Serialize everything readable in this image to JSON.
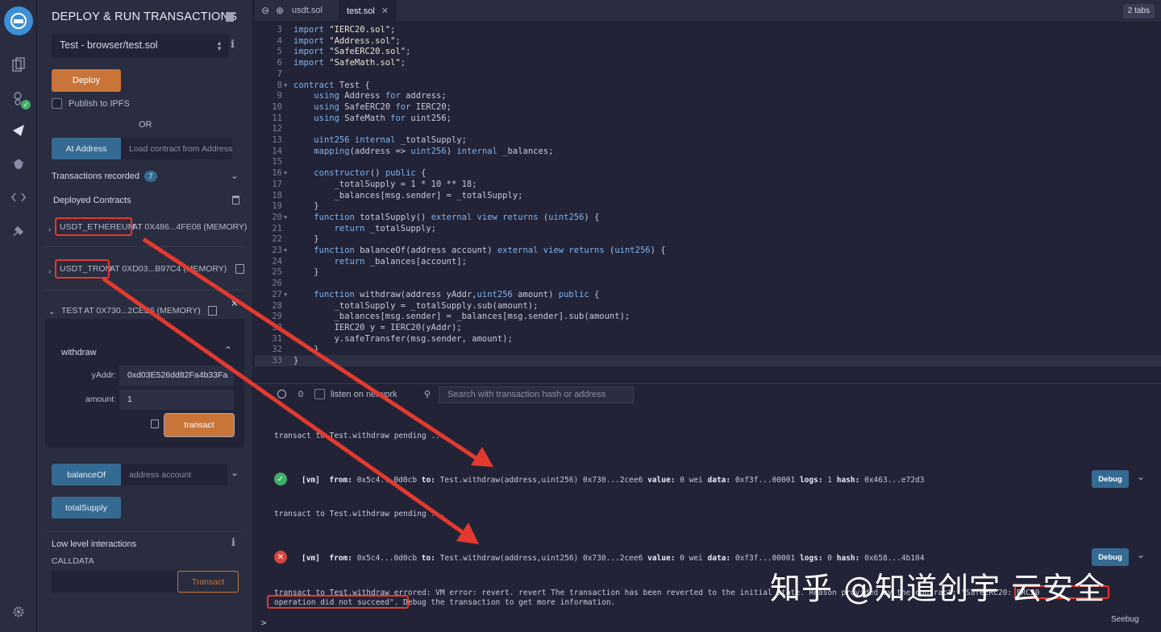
{
  "panel": {
    "title": "DEPLOY & RUN TRANSACTIONS",
    "contract_select": "Test - browser/test.sol",
    "deploy_label": "Deploy",
    "publish_label": "Publish to IPFS",
    "or_label": "OR",
    "at_address_label": "At Address",
    "load_contract_placeholder": "Load contract from Address",
    "transactions_recorded_label": "Transactions recorded",
    "transactions_count": "7",
    "deployed_contracts_label": "Deployed Contracts",
    "contracts": [
      {
        "name": "USDT_ETHEREUM",
        "rest": " AT 0X486...4FE08 (MEMORY)"
      },
      {
        "name": "USDT_TRON",
        "rest": " AT 0XD03...B97C4 (MEMORY)"
      },
      {
        "name": "TEST",
        "rest": " AT 0X730...2CEE6 (MEMORY)"
      }
    ],
    "withdraw": {
      "name": "withdraw",
      "param1_label": "yAddr:",
      "param1_value": "0xd03E526dd82Fa4b33Fa",
      "param2_label": "amount:",
      "param2_value": "1",
      "transact_label": "transact"
    },
    "balance_of_label": "balanceOf",
    "balance_of_placeholder": "address account",
    "total_supply_label": "totalSupply",
    "low_level_label": "Low level interactions",
    "calldata_label": "CALLDATA",
    "transact_label": "Transact"
  },
  "tabs": [
    {
      "label": "usdt.sol",
      "active": false
    },
    {
      "label": "test.sol",
      "active": true
    }
  ],
  "tabs_count": "2 tabs",
  "code_lines": [
    {
      "n": "3",
      "html": "<span class='kw'>import</span> <span class='str'>\"IERC20.sol\"</span>;"
    },
    {
      "n": "4",
      "html": "<span class='kw'>import</span> <span class='str'>\"Address.sol\"</span>;"
    },
    {
      "n": "5",
      "html": "<span class='kw'>import</span> <span class='str'>\"SafeERC20.sol\"</span>;"
    },
    {
      "n": "6",
      "html": "<span class='kw'>import</span> <span class='str'>\"SafeMath.sol\"</span>;"
    },
    {
      "n": "7",
      "html": ""
    },
    {
      "n": "8",
      "html": "<span class='kw'>contract</span> Test {",
      "fold": true
    },
    {
      "n": "9",
      "html": "    <span class='kw'>using</span> Address <span class='kw'>for</span> address;"
    },
    {
      "n": "10",
      "html": "    <span class='kw'>using</span> SafeERC20 <span class='kw'>for</span> IERC20;"
    },
    {
      "n": "11",
      "html": "    <span class='kw'>using</span> SafeMath <span class='kw'>for</span> uint256;"
    },
    {
      "n": "12",
      "html": ""
    },
    {
      "n": "13",
      "html": "    <span class='kw'>uint256</span> <span class='kw'>internal</span> _totalSupply;"
    },
    {
      "n": "14",
      "html": "    <span class='kw'>mapping</span>(address => <span class='kw'>uint256</span>) <span class='kw'>internal</span> _balances;"
    },
    {
      "n": "15",
      "html": ""
    },
    {
      "n": "16",
      "html": "    <span class='kw'>constructor</span>() <span class='kw'>public</span> {",
      "fold": true
    },
    {
      "n": "17",
      "html": "        _totalSupply = 1 * 10 ** 18;"
    },
    {
      "n": "18",
      "html": "        _balances[msg.sender] = _totalSupply;"
    },
    {
      "n": "19",
      "html": "    }"
    },
    {
      "n": "20",
      "html": "    <span class='kw'>function</span> totalSupply() <span class='kw'>external</span> <span class='kw'>view</span> <span class='kw'>returns</span> (<span class='kw'>uint256</span>) {",
      "fold": true
    },
    {
      "n": "21",
      "html": "        <span class='kw'>return</span> _totalSupply;"
    },
    {
      "n": "22",
      "html": "    }"
    },
    {
      "n": "23",
      "html": "    <span class='kw'>function</span> balanceOf(address account) <span class='kw'>external</span> <span class='kw'>view</span> <span class='kw'>returns</span> (<span class='kw'>uint256</span>) {",
      "fold": true
    },
    {
      "n": "24",
      "html": "        <span class='kw'>return</span> _balances[account];"
    },
    {
      "n": "25",
      "html": "    }"
    },
    {
      "n": "26",
      "html": ""
    },
    {
      "n": "27",
      "html": "    <span class='kw'>function</span> withdraw(address yAddr,<span class='kw'>uint256</span> amount) <span class='kw'>public</span> {",
      "fold": true
    },
    {
      "n": "28",
      "html": "        _totalSupply = _totalSupply.sub(amount);"
    },
    {
      "n": "29",
      "html": "        _balances[msg.sender] = _balances[msg.sender].sub(amount);"
    },
    {
      "n": "30",
      "html": "        IERC20 y = IERC20(yAddr);"
    },
    {
      "n": "31",
      "html": "        y.safeTransfer(msg.sender, amount);"
    },
    {
      "n": "32",
      "html": "    }"
    },
    {
      "n": "33",
      "html": "}"
    }
  ],
  "terminal": {
    "count": "0",
    "listen_label": "listen on network",
    "search_placeholder": "Search with transaction hash or address",
    "pending1": "transact to Test.withdraw pending ...",
    "tx1": {
      "vm": "[vm]",
      "from_label": "from:",
      "from": "0x5c4...0d0cb",
      "to_label": "to:",
      "to": "Test.withdraw(address,uint256) 0x730...2cee6",
      "value_label": "value:",
      "value": "0 wei",
      "data_label": "data:",
      "data": "0xf3f...00001",
      "logs_label": "logs:",
      "logs": "1",
      "hash_label": "hash:",
      "hash": "0x463...e72d3"
    },
    "pending2": "transact to Test.withdraw pending ...",
    "tx2": {
      "vm": "[vm]",
      "from_label": "from:",
      "from": "0x5c4...0d0cb",
      "to_label": "to:",
      "to": "Test.withdraw(address,uint256) 0x730...2cee6",
      "value_label": "value:",
      "value": "0 wei",
      "data_label": "data:",
      "data": "0xf3f...00001",
      "logs_label": "logs:",
      "logs": "0",
      "hash_label": "hash:",
      "hash": "0x658...4b104"
    },
    "debug_label": "Debug",
    "error_line1": "transact to Test.withdraw errored: VM error: revert. revert The transaction has been reverted to the initial state. Reason provided by the contract: \"SafeERC20: ERC20",
    "error_line2_hl": "operation did not succeed\".",
    "error_line2_rest": " Debug the transaction to get more information.",
    "prompt": ">"
  },
  "watermark": "知乎 @知道创宇 云安全",
  "seebug": "Seebug",
  "colors": {
    "accent_orange": "#c97539",
    "accent_blue": "#356a92",
    "highlight_red": "#e23a2e",
    "bg": "#222336",
    "panel": "#2a2c3f"
  }
}
